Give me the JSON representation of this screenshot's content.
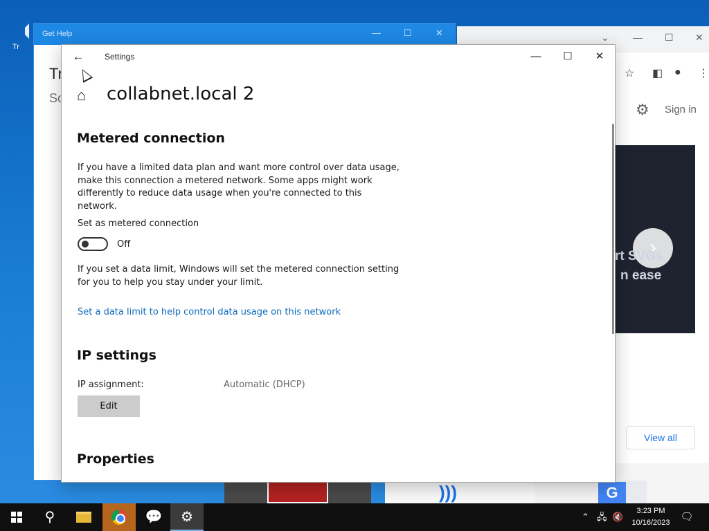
{
  "desktop": {
    "icon_label": "Tr"
  },
  "chrome": {
    "sign_in": "Sign in",
    "banner_line1": "rt SVGs",
    "banner_line2": "n ease",
    "view_all": "View all"
  },
  "get_help": {
    "title": "Get Help",
    "text1": "Tr",
    "text2": "Sc"
  },
  "settings": {
    "app_name": "Settings",
    "page_title": "collabnet.local 2",
    "metered": {
      "heading": "Metered connection",
      "description": "If you have a limited data plan and want more control over data usage, make this connection a metered network. Some apps might work differently to reduce data usage when you're connected to this network.",
      "toggle_label": "Set as metered connection",
      "toggle_state": "Off",
      "toggle_on": false,
      "data_limit_note": "If you set a data limit, Windows will set the metered connection setting for you to help you stay under your limit.",
      "data_limit_link": "Set a data limit to help control data usage on this network"
    },
    "ip": {
      "heading": "IP settings",
      "assignment_label": "IP assignment:",
      "assignment_value": "Automatic (DHCP)",
      "edit_label": "Edit"
    },
    "properties": {
      "heading": "Properties"
    }
  },
  "taskbar": {
    "time": "3:23 PM",
    "date": "10/16/2023"
  },
  "icons": {
    "back": "arrow-left",
    "home": "home",
    "minimize": "minimize",
    "maximize": "maximize",
    "close": "close"
  },
  "colors": {
    "link": "#0f6cbd",
    "taskbar": "#101010",
    "get_help_title": "#1e88e5",
    "desktop": "#0b5fb8"
  }
}
